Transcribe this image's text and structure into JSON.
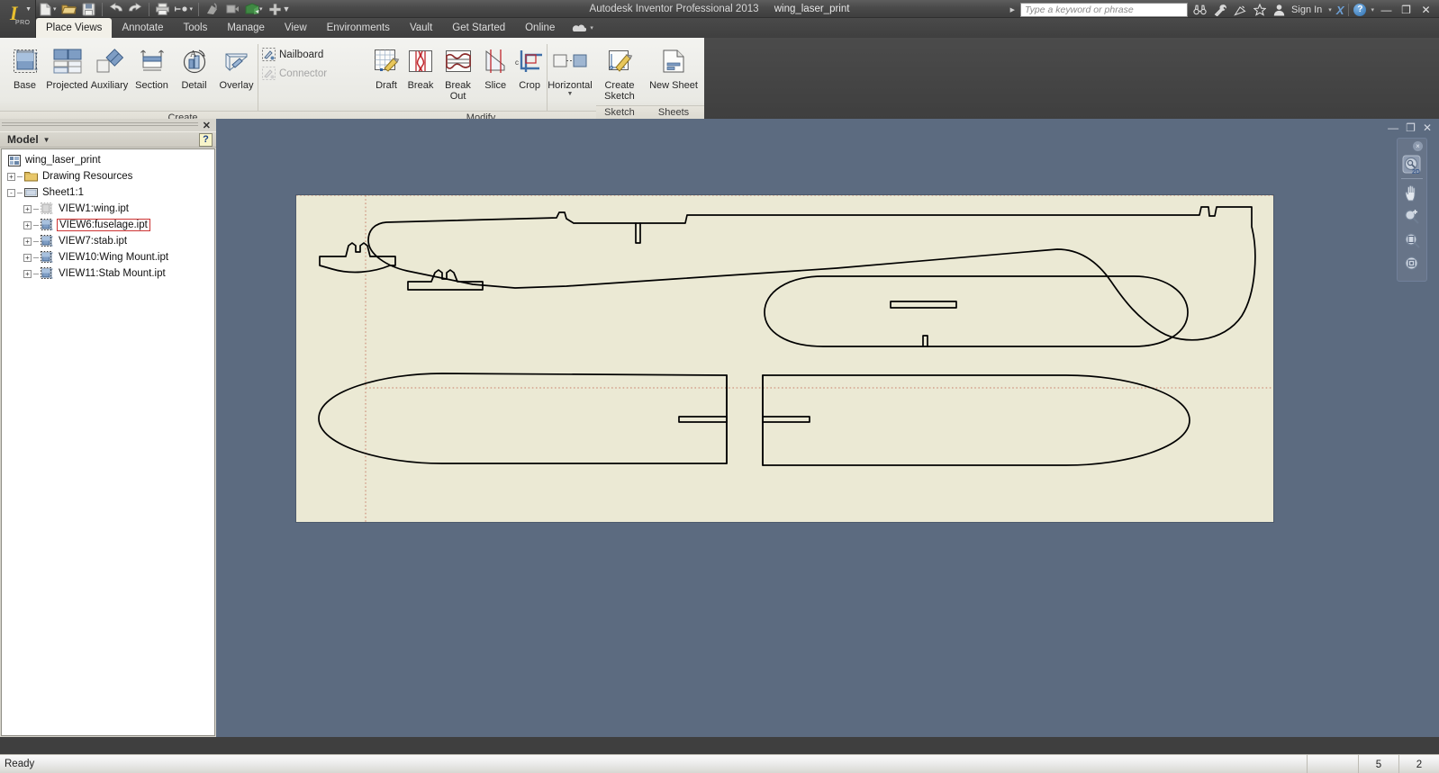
{
  "window": {
    "app_title": "Autodesk Inventor Professional 2013",
    "document_name": "wing_laser_print",
    "minimize": "—",
    "restore": "❐",
    "close": "✕"
  },
  "quick_access": {
    "icons": [
      "new-document-icon",
      "open-folder-icon",
      "save-icon",
      "undo-icon",
      "redo-icon",
      "print-icon",
      "select-icon",
      "update-icon",
      "return-icon",
      "home-view-icon",
      "plus-icon",
      "customize-caret-icon"
    ]
  },
  "search": {
    "placeholder": "Type a keyword or phrase",
    "value": ""
  },
  "titlebar_tools": {
    "icons": [
      "binoculars-search-icon",
      "wrench-icon",
      "satellite-icon",
      "favorites-star-icon",
      "user-icon"
    ],
    "sign_in": "Sign In",
    "exchange_label": "X",
    "help": "?"
  },
  "ribbon_tabs": [
    {
      "label": "Place Views",
      "active": true
    },
    {
      "label": "Annotate",
      "active": false
    },
    {
      "label": "Tools",
      "active": false
    },
    {
      "label": "Manage",
      "active": false
    },
    {
      "label": "View",
      "active": false
    },
    {
      "label": "Environments",
      "active": false
    },
    {
      "label": "Vault",
      "active": false
    },
    {
      "label": "Get Started",
      "active": false
    },
    {
      "label": "Online",
      "active": false
    }
  ],
  "ribbon": {
    "panels": [
      {
        "name": "Create",
        "label": "Create",
        "buttons": [
          {
            "label": "Base",
            "icon": "base-view-icon",
            "size": "big"
          },
          {
            "label": "Projected",
            "icon": "projected-view-icon",
            "size": "big"
          },
          {
            "label": "Auxiliary",
            "icon": "auxiliary-view-icon",
            "size": "big"
          },
          {
            "label": "Section",
            "icon": "section-view-icon",
            "size": "big"
          },
          {
            "label": "Detail",
            "icon": "detail-view-icon",
            "size": "big"
          },
          {
            "label": "Overlay",
            "icon": "overlay-view-icon",
            "size": "big"
          },
          {
            "label": "Nailboard",
            "icon": "nailboard-icon",
            "size": "small",
            "disabled": false
          },
          {
            "label": "Connector",
            "icon": "connector-icon",
            "size": "small",
            "disabled": true
          }
        ]
      },
      {
        "name": "Modify",
        "label": "Modify",
        "buttons": [
          {
            "label": "Draft",
            "icon": "draft-view-icon",
            "size": "big"
          },
          {
            "label": "Break",
            "icon": "break-icon",
            "size": "big"
          },
          {
            "label": "Break Out",
            "icon": "break-out-icon",
            "size": "big"
          },
          {
            "label": "Slice",
            "icon": "slice-icon",
            "size": "big"
          },
          {
            "label": "Crop",
            "icon": "crop-icon",
            "size": "big"
          },
          {
            "label": "Horizontal",
            "icon": "horizontal-align-icon",
            "size": "big",
            "has_dropdown": true
          }
        ]
      },
      {
        "name": "Sketch",
        "label": "Sketch",
        "buttons": [
          {
            "label": "Create\nSketch",
            "label_line1": "Create",
            "label_line2": "Sketch",
            "icon": "create-sketch-icon",
            "size": "big"
          }
        ]
      },
      {
        "name": "Sheets",
        "label": "Sheets",
        "buttons": [
          {
            "label": "New Sheet",
            "icon": "new-sheet-icon",
            "size": "big"
          }
        ]
      }
    ]
  },
  "browser_panel": {
    "title": "Model",
    "dropdown_caret": "▼",
    "help_badge": "?",
    "close": "✕",
    "tree": [
      {
        "label": "wing_laser_print",
        "indent": 0,
        "expander": "",
        "icon": "document-icon",
        "selected": false
      },
      {
        "label": "Drawing Resources",
        "indent": 1,
        "expander": "+",
        "icon": "folder-icon",
        "selected": false
      },
      {
        "label": "Sheet1:1",
        "indent": 1,
        "expander": "-",
        "icon": "sheet-icon",
        "selected": false
      },
      {
        "label": "VIEW1:wing.ipt",
        "indent": 2,
        "expander": "+",
        "icon": "view-inactive-icon",
        "selected": false
      },
      {
        "label": "VIEW6:fuselage.ipt",
        "indent": 2,
        "expander": "+",
        "icon": "view-icon",
        "selected": true
      },
      {
        "label": "VIEW7:stab.ipt",
        "indent": 2,
        "expander": "+",
        "icon": "view-icon",
        "selected": false
      },
      {
        "label": "VIEW10:Wing Mount.ipt",
        "indent": 2,
        "expander": "+",
        "icon": "view-icon",
        "selected": false
      },
      {
        "label": "VIEW11:Stab Mount.ipt",
        "indent": 2,
        "expander": "+",
        "icon": "view-icon",
        "selected": false
      }
    ]
  },
  "canvas": {
    "background_color": "#5c6b80",
    "sheet_color": "#ebe9d4",
    "line_color": "#000000",
    "view_boundary_color": "#c87f6a",
    "window_buttons": {
      "minimize": "—",
      "restore": "❐",
      "close": "✕"
    },
    "navbar": {
      "close": "×",
      "tools": [
        "full-navigation-wheel-2d-icon",
        "pan-icon",
        "zoom-icon",
        "zoom-window-icon",
        "zoom-all-icon"
      ]
    }
  },
  "status_bar": {
    "message": "Ready",
    "cells": [
      "",
      "5",
      "2"
    ]
  }
}
